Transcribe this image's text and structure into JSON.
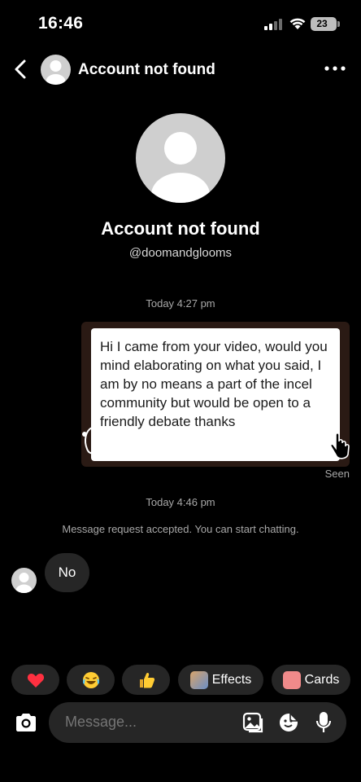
{
  "status_bar": {
    "time": "16:46",
    "battery": "23"
  },
  "header": {
    "title": "Account not found"
  },
  "profile": {
    "name": "Account not found",
    "handle": "@doomandglooms"
  },
  "thread": {
    "timestamp_1": "Today 4:27 pm",
    "sent_message": "Hi I came from your video, would you mind elaborating on what you said, I am by no means a part of the incel community but would be open to a friendly debate thanks",
    "seen_label": "Seen",
    "timestamp_2": "Today 4:46 pm",
    "system_message": "Message request accepted. You can start chatting.",
    "received_message": "No"
  },
  "quick_reactions": {
    "heart_icon": "red-heart-icon",
    "laugh_icon": "laughing-face-icon",
    "thumb_icon": "thumbs-up-icon",
    "effects_label": "Effects",
    "cards_label": "Cards"
  },
  "composer": {
    "placeholder": "Message..."
  },
  "colors": {
    "background": "#000000",
    "bubble_dark": "#262626",
    "heart": "#ff3040"
  }
}
